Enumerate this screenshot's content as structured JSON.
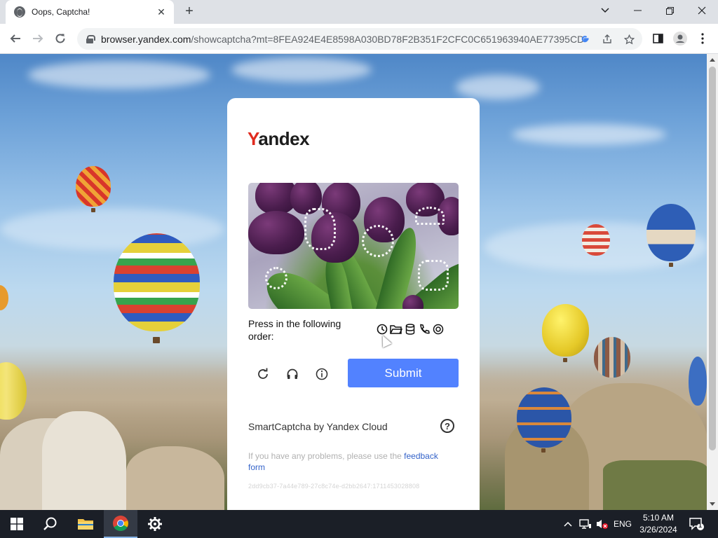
{
  "browser": {
    "tab_title": "Oops, Captcha!",
    "new_tab": "+",
    "url_host": "browser.yandex.com",
    "url_path": "/showcaptcha?mt=8FEA924E4E8598A030BD78F2B351F2CFC0C651963940AE77395CD8..."
  },
  "captcha": {
    "logo_first": "Y",
    "logo_rest": "andex",
    "prompt": "Press in the following order:",
    "submit_label": "Submit",
    "brand": "SmartCaptcha by Yandex Cloud",
    "help": "?",
    "feedback_text": "If you have any problems, please use the ",
    "feedback_link": "feedback form",
    "hash": "2dd9cb37-7a44e789-27c8c74e-d2bb2647:1711453028808",
    "order_icons": [
      "clock-icon",
      "folder-icon",
      "database-icon",
      "phone-icon",
      "target-icon"
    ],
    "submit_color": "#5282ff",
    "logo_accent": "#e02b1f"
  },
  "taskbar": {
    "lang": "ENG",
    "time": "5:10 AM",
    "date": "3/26/2024",
    "notifications": "1"
  }
}
